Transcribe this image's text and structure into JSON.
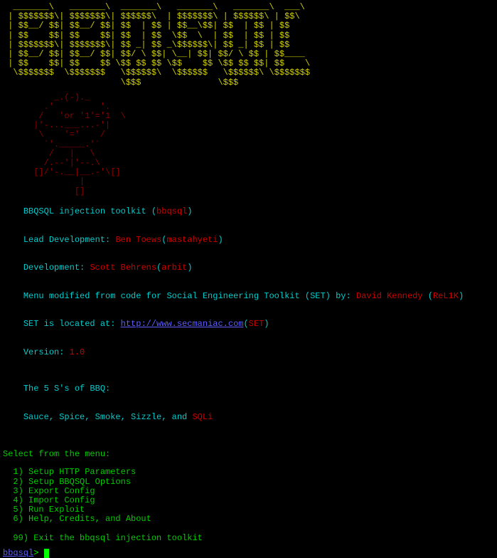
{
  "ascii_banner": "  _______\\   _______\\  _______\\   _______\\   _______\\  ___\\\n | $$$$$$$\\| $$$$$$$\\| $$$$$$\\  | $$$$$$$\\ | $$$$$$\\ | $$\\\n | $$__/ $$| $$__/ $$| $$  | $$ | $$__\\$$| $$  | $$ | $$\n | $$    $$| $$    $$| $$  | $$  \\$$  \\  | $$  | $$ | $$\n | $$$$$$$\\| $$$$$$$\\| $$ _| $$ _\\$$$$$$\\| $$ _| $$ | $$\n | $$__/ $$| $$__/ $$| $$/ \\ $$| \\__| $$| $$/ \\ $$ | $$____\n | $$    $$| $$    $$ \\$$ $$ $$ \\$$    $$ \\$$ $$ $$| $$    \\\n  \\$$$$$$$  \\$$$$$$$   \\$$$$$$\\  \\$$$$$$   \\$$$$$$\\ \\$$$$$$$\n                       \\$$$               \\$$$",
  "ascii_grill": "          _.(-)._\n        .'         '.\n       /   'or '1'='1  \\\n      |'-...___...-'|\n       \\    '='    /\n        `'._____.'`\n         /   |   \\\n        /.--'|'--.\\\n      []/'-.__|__.-'\\[]\n               |\n              []",
  "info": {
    "line1_a": "BBQSQL injection toolkit (",
    "line1_b": "bbqsql",
    "line1_c": ")",
    "lead_a": "Lead Development: ",
    "lead_name": "Ben Toews",
    "lead_b": "(",
    "lead_handle": "mastahyeti",
    "lead_c": ")",
    "dev_a": "Development: ",
    "dev_name": "Scott Behrens",
    "dev_b": "(",
    "dev_handle": "arbit",
    "dev_c": ")",
    "menu_a": "Menu modified from code for Social Engineering Toolkit (SET) by: ",
    "menu_name": "David Kennedy",
    "menu_b": " (",
    "menu_handle": "ReL1K",
    "menu_c": ")",
    "loc_a": "SET is located at: ",
    "loc_url": "http://www.secmaniac.com",
    "loc_b": "(",
    "loc_c": "SET",
    "loc_d": ")",
    "ver_a": "Version: ",
    "ver_b": "1.0",
    "bbq_a": "The 5 S's of BBQ:",
    "bbq_b": "Sauce, Spice, Smoke, Sizzle, and ",
    "bbq_c": "SQLi"
  },
  "menu": {
    "header": "Select from the menu:",
    "items": [
      "  1) Setup HTTP Parameters",
      "  2) Setup BBQSQL Options",
      "  3) Export Config",
      "  4) Import Config",
      "  5) Run Exploit",
      "  6) Help, Credits, and About",
      "",
      "  99) Exit the bbqsql injection toolkit"
    ]
  },
  "prompt": {
    "label": "bbqsql",
    "sep": "> "
  }
}
